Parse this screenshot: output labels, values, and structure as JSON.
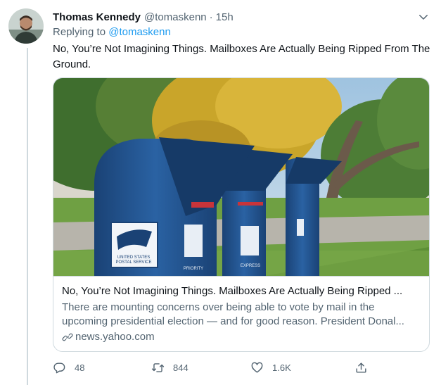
{
  "tweet": {
    "author_name": "Thomas Kennedy",
    "author_handle": "@tomaskenn",
    "dot": "·",
    "time": "15h",
    "replying_prefix": "Replying to",
    "replying_to": "@tomaskenn",
    "text": "No, You’re Not Imagining Things. Mailboxes Are Actually Being Ripped From The Ground."
  },
  "card": {
    "title": "No, You’re Not Imagining Things. Mailboxes Are Actually Being Ripped ...",
    "description_line1": "There are mounting concerns over being able to vote by mail in the",
    "description_line2": "upcoming presidential election — and for good reason. President Donal...",
    "domain": "news.yahoo.com",
    "image_text": {
      "mailbox_label_line1": "UNITED STATES",
      "mailbox_label_line2": "POSTAL SERVICE",
      "priority": "PRIORITY",
      "express": "EXPRESS"
    }
  },
  "actions": {
    "reply_count": "48",
    "retweet_count": "844",
    "like_count": "1.6K"
  },
  "colors": {
    "text_primary": "#0f1419",
    "text_secondary": "#536471",
    "accent": "#1d9bf0",
    "border": "#cfd9de",
    "mailbox_blue": "#1f4f8a"
  },
  "icons": [
    "chevron-down-icon",
    "link-icon",
    "reply-icon",
    "retweet-icon",
    "like-icon",
    "share-icon"
  ]
}
